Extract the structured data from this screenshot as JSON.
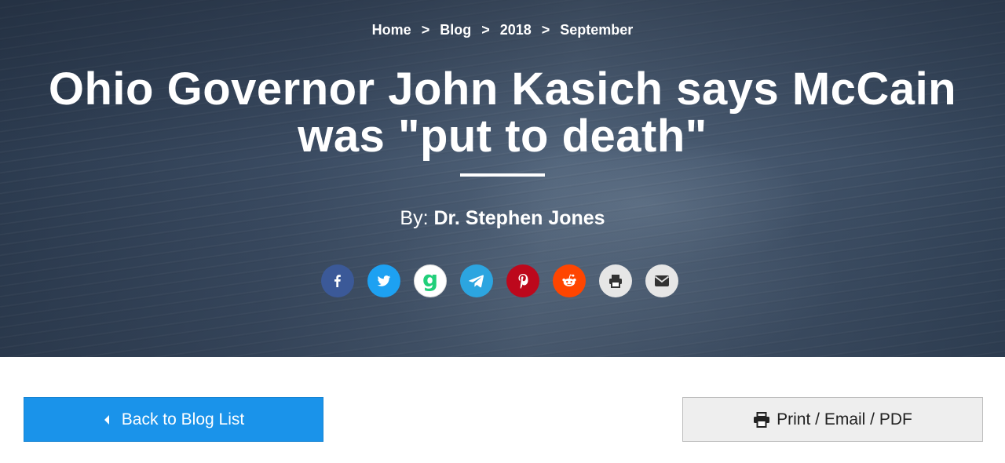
{
  "breadcrumb": {
    "items": [
      "Home",
      "Blog",
      "2018",
      "September"
    ],
    "separator": ">"
  },
  "article": {
    "title_line1": "Ohio Governor John Kasich says McCain",
    "title_line2": "was \"put to death\"",
    "byline_prefix": "By:",
    "author": "Dr. Stephen Jones"
  },
  "share": {
    "icons": [
      {
        "name": "facebook-icon",
        "color": "#3b5998"
      },
      {
        "name": "twitter-icon",
        "color": "#1da1f2"
      },
      {
        "name": "gab-icon",
        "color": "#ffffff",
        "glyph": "g",
        "glyph_color": "#21cf7a"
      },
      {
        "name": "telegram-icon",
        "color": "#2ca5e0"
      },
      {
        "name": "pinterest-icon",
        "color": "#bd081c"
      },
      {
        "name": "reddit-icon",
        "color": "#ff4500"
      },
      {
        "name": "print-icon",
        "color": "#e6e6e6"
      },
      {
        "name": "email-icon",
        "color": "#e6e6e6"
      }
    ]
  },
  "actions": {
    "back_label": "Back to Blog List",
    "print_label": "Print / Email / PDF",
    "back_color": "#1a93ea",
    "print_color": "#eeeeee"
  }
}
